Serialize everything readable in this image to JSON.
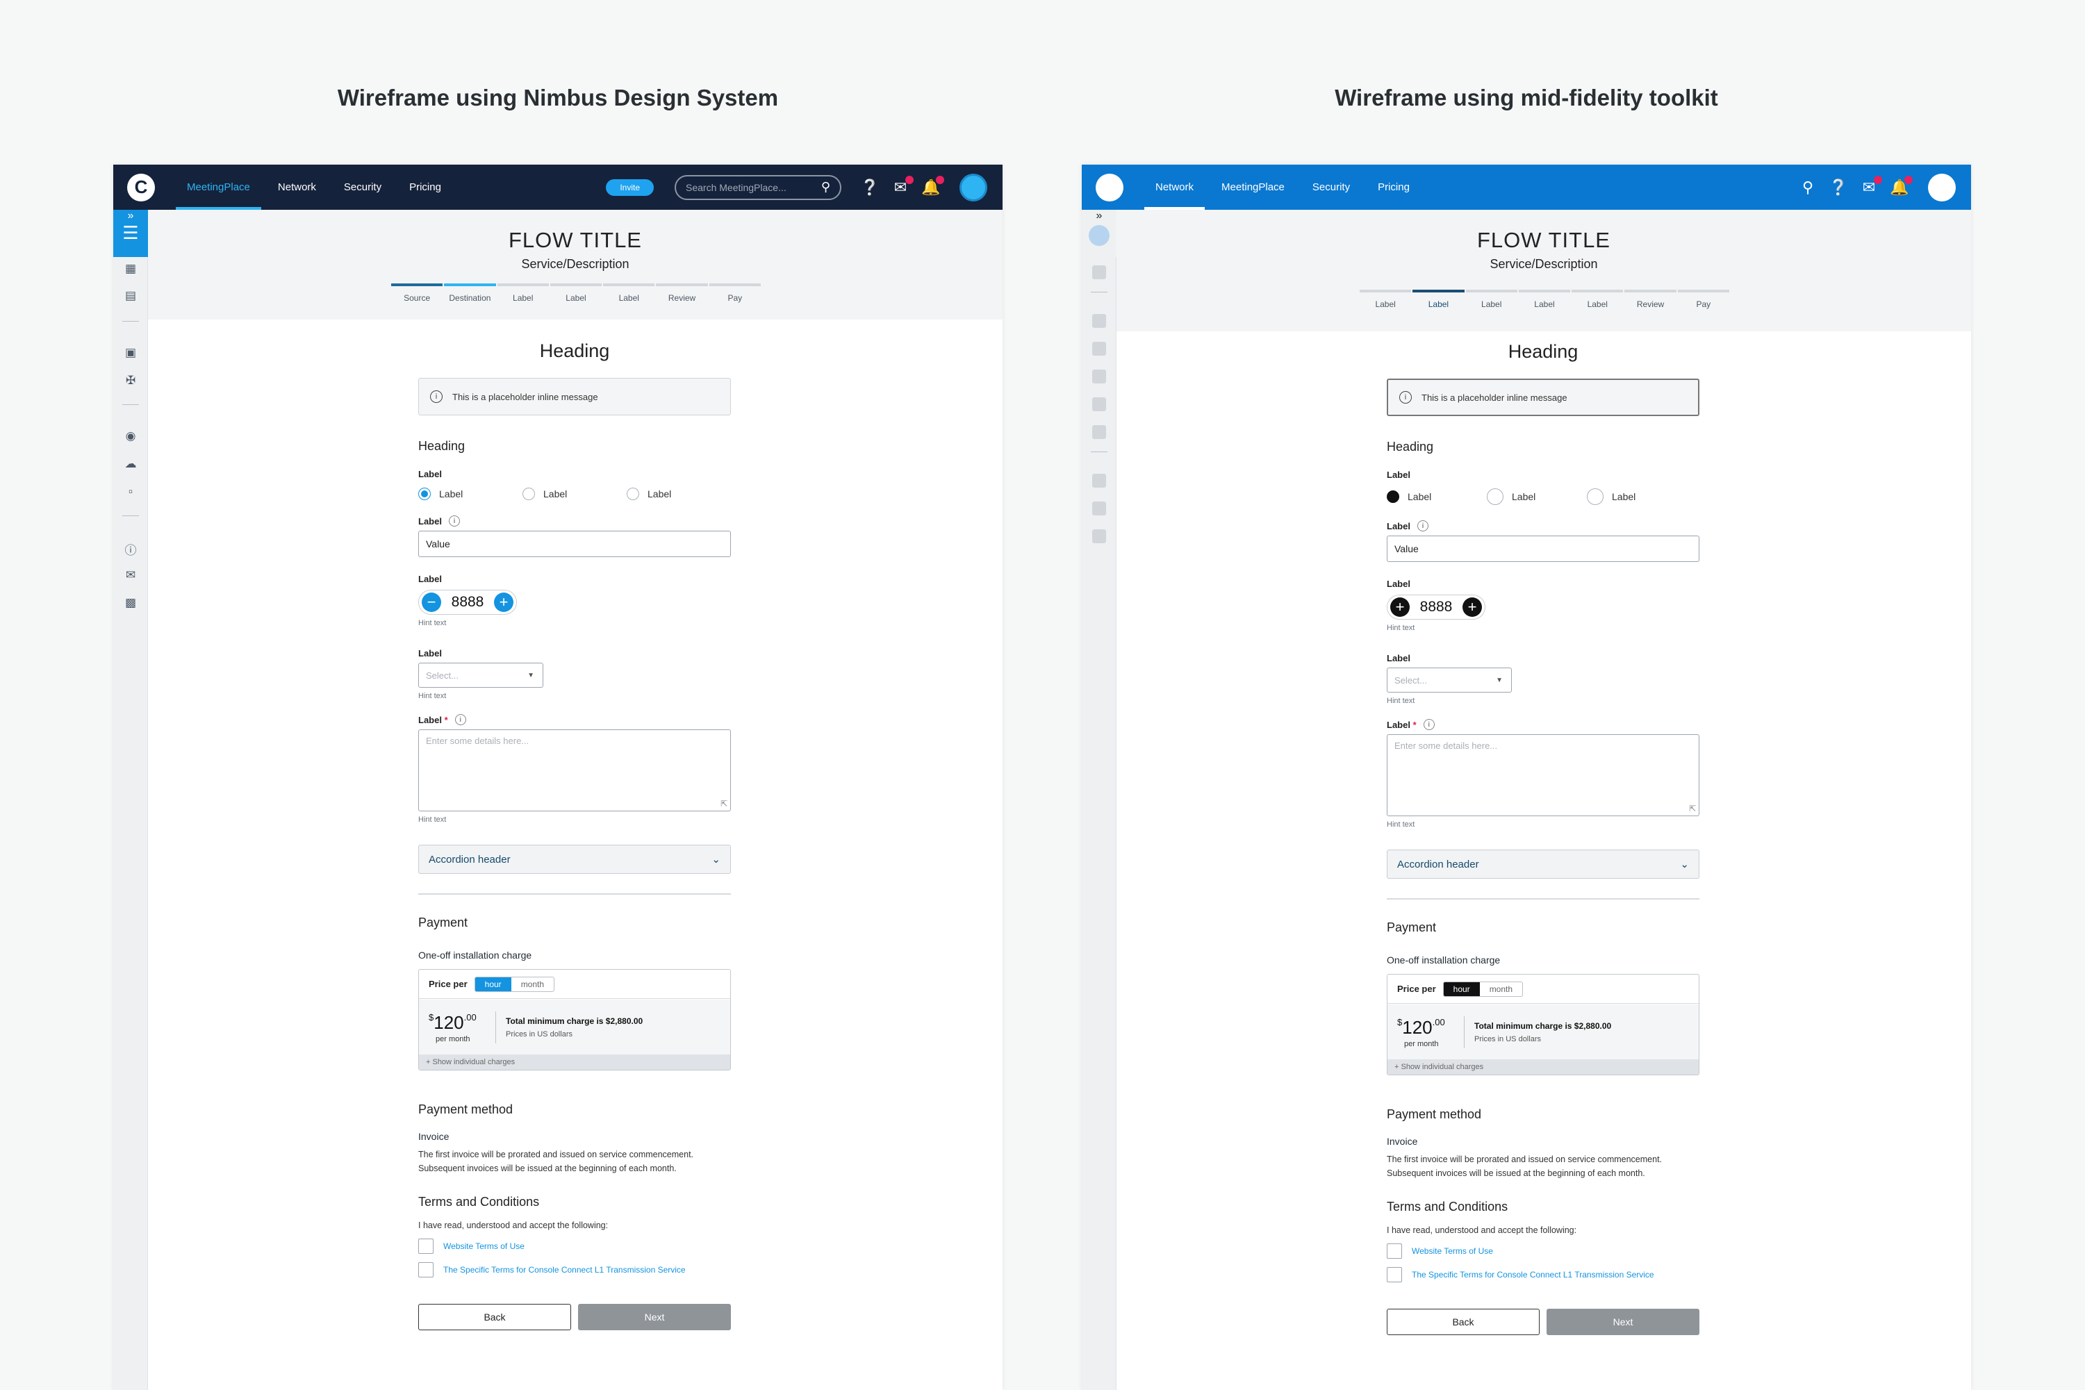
{
  "titles": {
    "left": "Wireframe using Nimbus Design System",
    "right": "Wireframe using mid-fidelity toolkit"
  },
  "left": {
    "logo": "C",
    "nav": [
      "MeetingPlace",
      "Network",
      "Security",
      "Pricing"
    ],
    "invite": "Invite",
    "search_placeholder": "Search MeetingPlace...",
    "steps": [
      "Source",
      "Destination",
      "Label",
      "Label",
      "Label",
      "Review",
      "Pay"
    ]
  },
  "right": {
    "nav": [
      "Network",
      "MeetingPlace",
      "Security",
      "Pricing"
    ],
    "steps": [
      "Label",
      "Label",
      "Label",
      "Label",
      "Label",
      "Review",
      "Pay"
    ]
  },
  "flow": {
    "title": "FLOW TITLE",
    "subtitle": "Service/Description"
  },
  "form": {
    "heading": "Heading",
    "inline_message": "This is a placeholder inline message",
    "section_heading": "Heading",
    "radio_label": "Label",
    "radio_options": [
      "Label",
      "Label",
      "Label"
    ],
    "text_label": "Label",
    "text_value": "Value",
    "stepper_label": "Label",
    "stepper_value": "8888",
    "hint": "Hint text",
    "select_label": "Label",
    "select_placeholder": "Select...",
    "textarea_label": "Label",
    "required_mark": "*",
    "textarea_placeholder": "Enter some details here...",
    "accordion": "Accordion header",
    "payment_heading": "Payment",
    "install_charge": "One-off installation charge",
    "price_per": "Price per",
    "toggle": [
      "hour",
      "month"
    ],
    "currency": "$",
    "amount": "120",
    "amount_decimals": ".00",
    "per_month": "per month",
    "total_min": "Total minimum charge is $2,880.00",
    "prices_in": "Prices in US dollars",
    "show_charges": "+ Show individual charges",
    "payment_method": "Payment method",
    "invoice": "Invoice",
    "invoice_text": "The first invoice will be prorated and issued on service commencement. Subsequent invoices will be issued at the beginning of each month.",
    "terms_heading": "Terms and Conditions",
    "terms_intro": "I have read, understood and accept the following:",
    "term1": "Website Terms of Use",
    "term2": "The Specific Terms for Console Connect L1 Transmission Service",
    "back": "Back",
    "next": "Next"
  },
  "colors": {
    "left_nav_bg": "#15223b",
    "right_nav_bg": "#0a78d0",
    "accent_blue": "#1393e0",
    "notification": "#e8215f"
  },
  "icons": [
    "search-icon",
    "help-icon",
    "chat-icon",
    "bell-icon",
    "user-avatar-icon",
    "info-icon",
    "chevron-down-icon",
    "expand-sidebar-icon"
  ]
}
